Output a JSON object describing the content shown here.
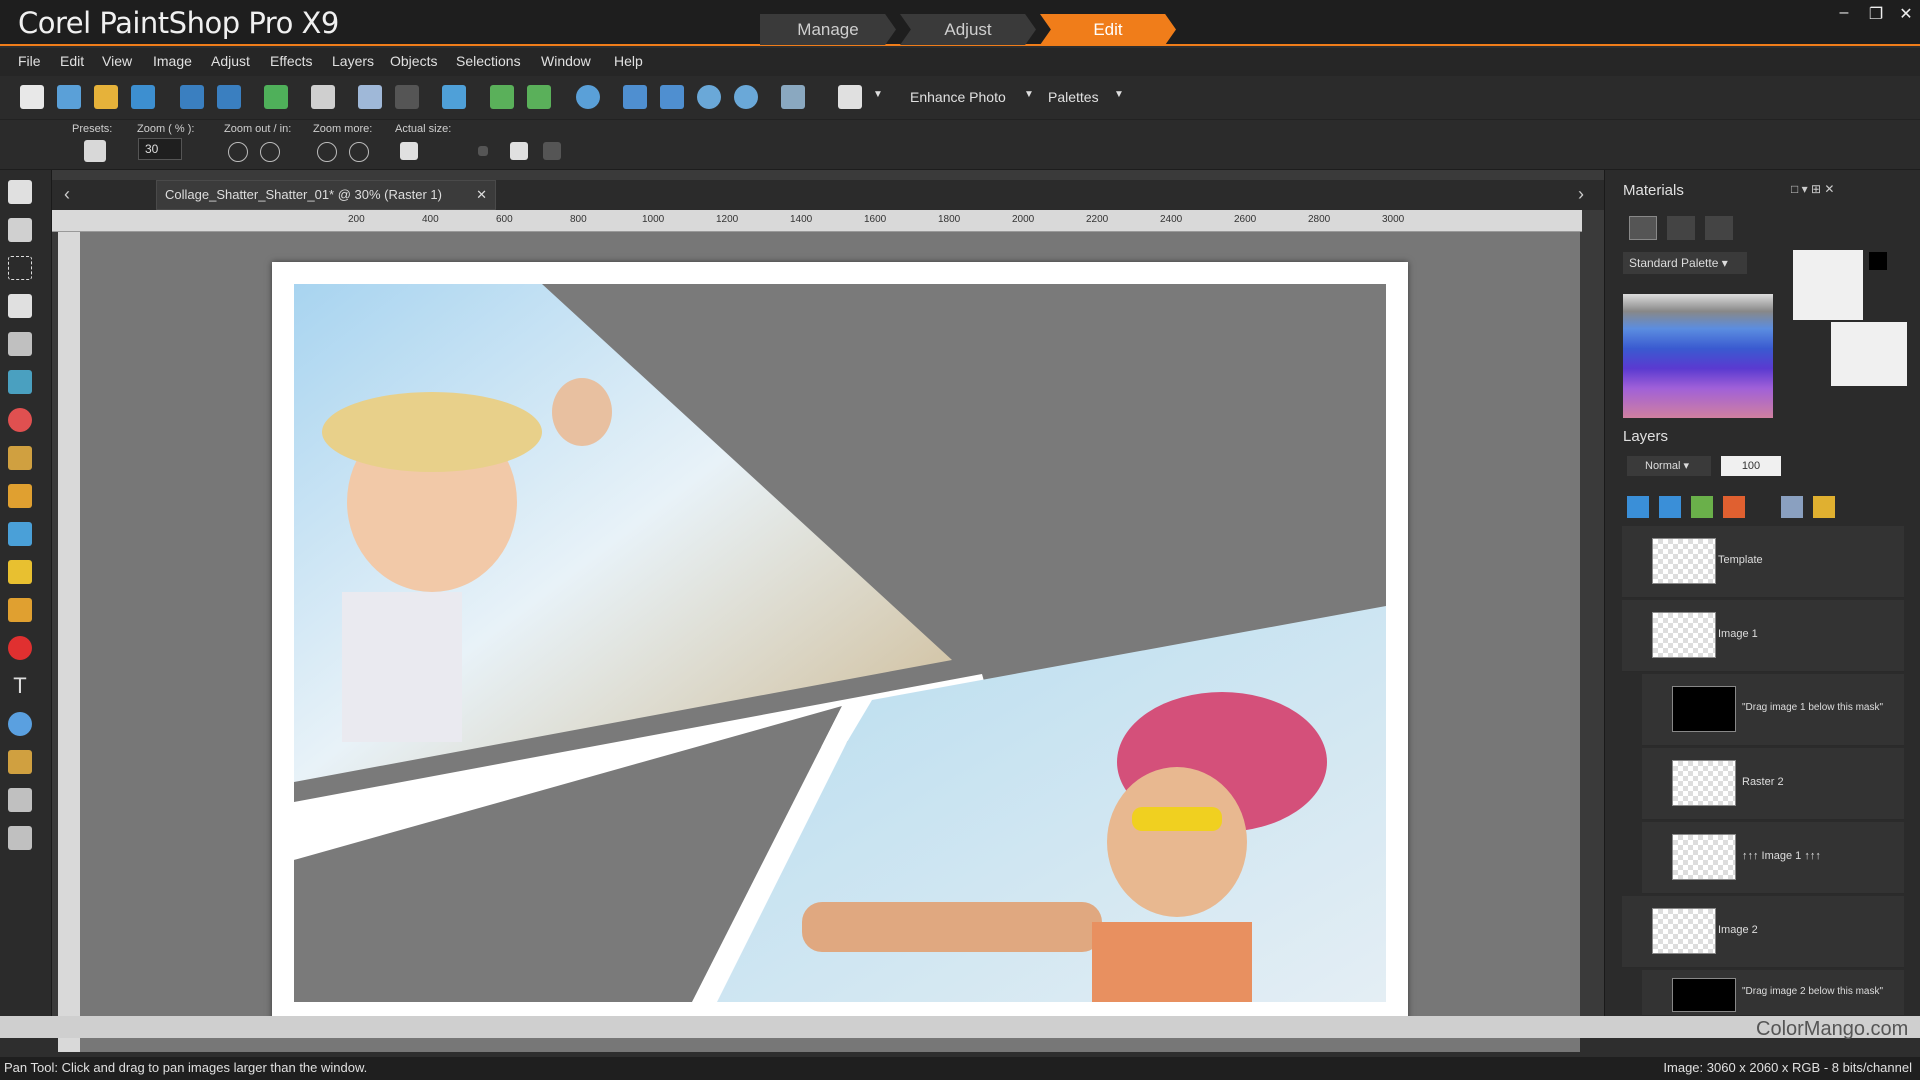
{
  "app": {
    "title_main": "Corel PaintShop Pro X9",
    "workspace_tabs": [
      "Manage",
      "Adjust",
      "Edit"
    ],
    "active_tab": "Edit"
  },
  "menu": [
    "File",
    "Edit",
    "View",
    "Image",
    "Adjust",
    "Effects",
    "Layers",
    "Objects",
    "Selections",
    "Window",
    "Help"
  ],
  "toolbar": {
    "enhance_label": "Enhance Photo",
    "palettes_label": "Palettes"
  },
  "options": {
    "presets": "Presets:",
    "zoom": "Zoom ( % ):",
    "zoom_value": "30",
    "zoom_outin": "Zoom out / in:",
    "zoom_more": "Zoom more:",
    "actual_size": "Actual size:"
  },
  "document": {
    "tab_title": "Collage_Shatter_Shatter_01* @  30% (Raster 1)",
    "ruler": [
      "200",
      "400",
      "600",
      "800",
      "1000",
      "1200",
      "1400",
      "1600",
      "1800",
      "2000",
      "2200",
      "2400",
      "2600",
      "2800",
      "3000"
    ]
  },
  "materials": {
    "title": "Materials",
    "palette": "Standard Palette"
  },
  "layers": {
    "title": "Layers",
    "blend": "Normal",
    "opacity": "100",
    "items": [
      {
        "name": "Template"
      },
      {
        "name": "Image 1"
      },
      {
        "name": "\"Drag image 1 below this mask\""
      },
      {
        "name": "Raster 2"
      },
      {
        "name": "↑↑↑ Image 1 ↑↑↑"
      },
      {
        "name": "Image 2"
      },
      {
        "name": "\"Drag image 2 below this mask\""
      }
    ]
  },
  "status": {
    "left": "Pan Tool: Click and drag to pan images larger than the window.",
    "right": "Image:  3060 x 2060 x RGB - 8 bits/channel"
  },
  "watermark": "ColorMango.com",
  "colors": {
    "accent": "#f07d1a"
  }
}
